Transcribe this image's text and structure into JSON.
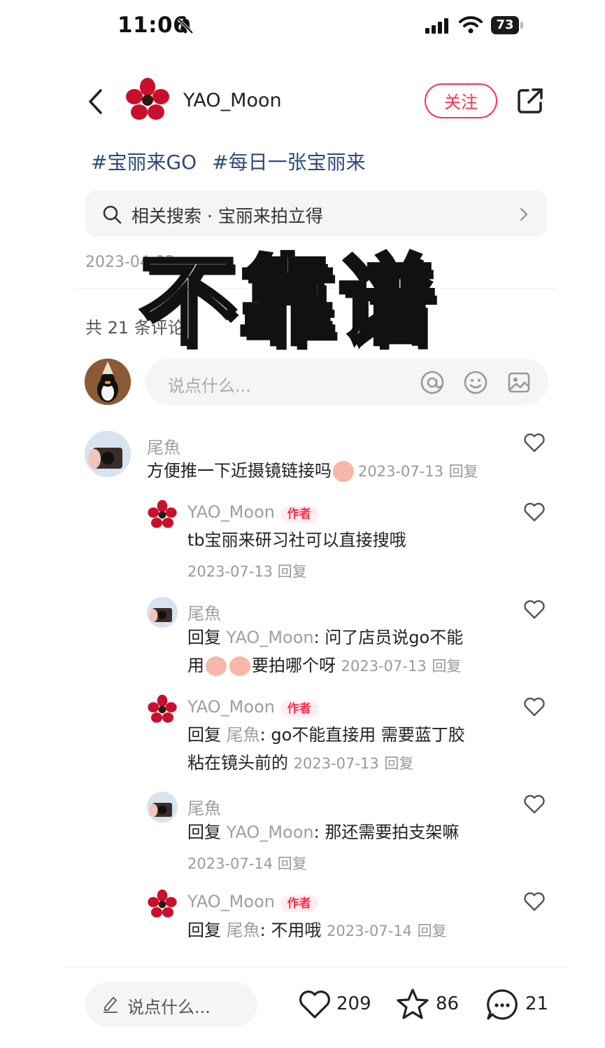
{
  "status_bar": {
    "time": "11:06",
    "battery": "73"
  },
  "header": {
    "author": "YAO_Moon",
    "follow_label": "关注"
  },
  "tags": [
    "#宝丽来GO",
    "#每日一张宝丽来"
  ],
  "related_search": "相关搜索 · 宝丽来拍立得",
  "post_date": "2023-04-03",
  "overlay_text": "不靠谱",
  "comment_count_label": "共 21 条评论",
  "comment_input_placeholder": "说点什么...",
  "comments": [
    {
      "author": "尾魚",
      "text": "方便推一下近摄镜链接吗",
      "date": "2023-07-13",
      "reply_label": "回复"
    },
    {
      "author": "YAO_Moon",
      "badge": "作者",
      "text": "tb宝丽来研习社可以直接搜哦",
      "date": "2023-07-13",
      "reply_label": "回复"
    },
    {
      "author": "尾魚",
      "reply_prefix": "回复",
      "reply_to": "YAO_Moon",
      "text_line1": ": 问了店员说go不能",
      "text_line2_pre": "用",
      "text_line2_post": "要拍哪个呀",
      "date": "2023-07-13",
      "reply_label": "回复"
    },
    {
      "author": "YAO_Moon",
      "badge": "作者",
      "reply_prefix": "回复",
      "reply_to": "尾魚",
      "text_line1": ": go不能直接用 需要蓝丁胶",
      "text_line2": "粘在镜头前的",
      "date": "2023-07-13",
      "reply_label": "回复"
    },
    {
      "author": "尾魚",
      "reply_prefix": "回复",
      "reply_to": "YAO_Moon",
      "text": ": 那还需要拍支架嘛",
      "date": "2023-07-14",
      "reply_label": "回复"
    },
    {
      "author": "YAO_Moon",
      "badge": "作者",
      "reply_prefix": "回复",
      "reply_to": "尾魚",
      "text": ": 不用哦",
      "date": "2023-07-14",
      "reply_label": "回复"
    }
  ],
  "bottom_bar": {
    "input_placeholder": "说点什么...",
    "likes": "209",
    "stars": "86",
    "comments": "21"
  },
  "colors": {
    "accent": "#ff2e4d",
    "tag": "#2d4a7a"
  },
  "icons": [
    "back-icon",
    "share-icon",
    "search-icon",
    "chevron-right-icon",
    "at-icon",
    "emoji-icon",
    "image-icon",
    "heart-icon",
    "star-icon",
    "comment-icon",
    "pen-icon",
    "bell-off-icon",
    "signal-icon",
    "wifi-icon"
  ]
}
